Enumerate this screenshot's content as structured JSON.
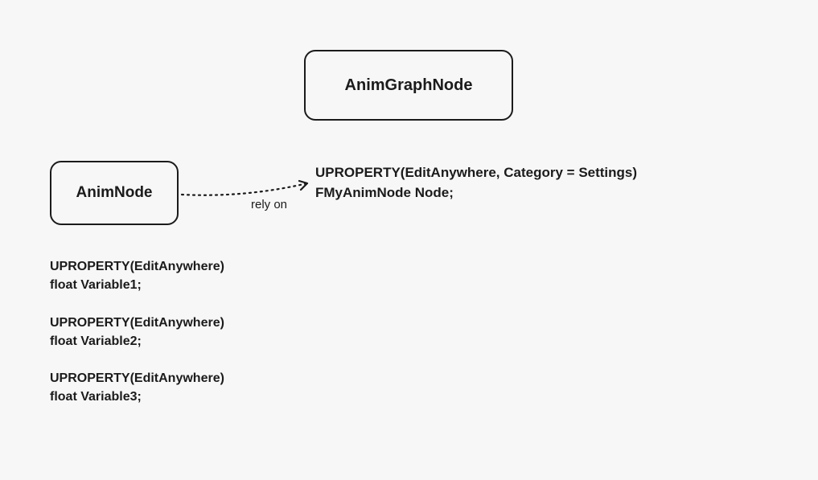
{
  "nodes": {
    "graph": {
      "title": "AnimGraphNode"
    },
    "anim": {
      "title": "AnimNode"
    }
  },
  "edge": {
    "label": "rely on"
  },
  "code": {
    "graph_props": "UPROPERTY(EditAnywhere, Category = Settings)\nFMyAnimNode Node;",
    "anim_props": "UPROPERTY(EditAnywhere)\nfloat Variable1;\n\nUPROPERTY(EditAnywhere)\nfloat Variable2;\n\nUPROPERTY(EditAnywhere)\nfloat Variable3;"
  }
}
